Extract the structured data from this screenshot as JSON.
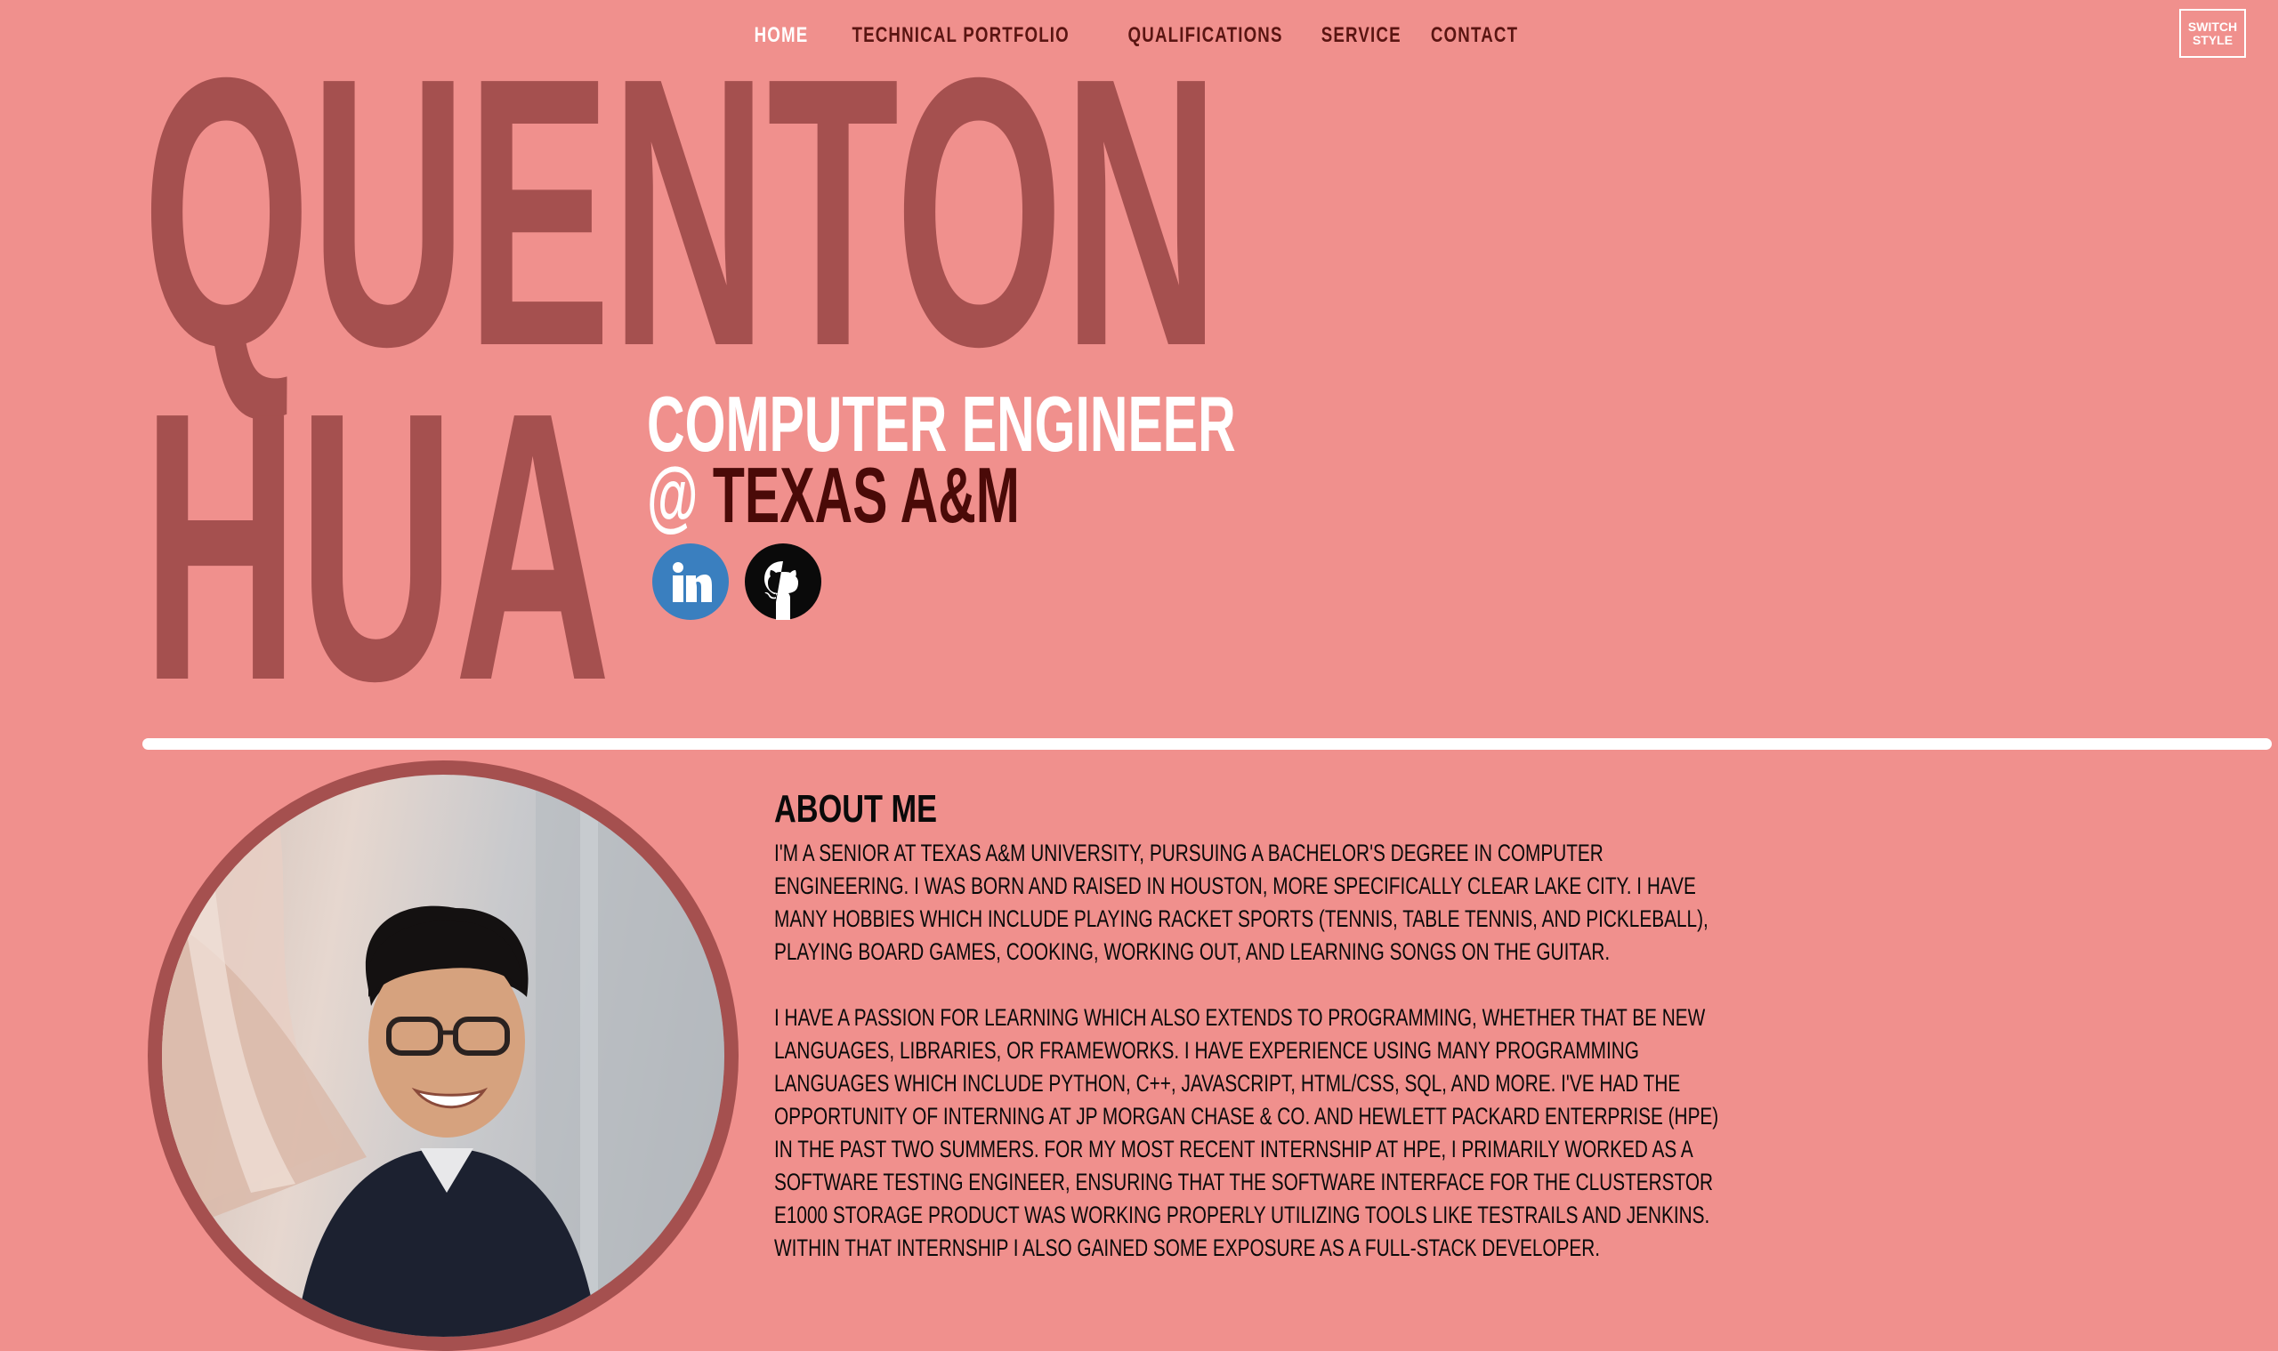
{
  "nav": {
    "items": [
      {
        "label": "HOME",
        "active": true
      },
      {
        "label": "TECHNICAL PORTFOLIO",
        "active": false
      },
      {
        "label": "QUALIFICATIONS",
        "active": false
      },
      {
        "label": "SERVICE",
        "active": false
      },
      {
        "label": "CONTACT",
        "active": false
      }
    ]
  },
  "switch_style": {
    "line1": "SWITCH",
    "line2": "STYLE"
  },
  "hero": {
    "first_name": "QUENTON",
    "last_name": "HUA",
    "role": "COMPUTER ENGINEER",
    "at": "@",
    "school": "TEXAS A&M"
  },
  "socials": {
    "linkedin_icon": "linkedin-icon",
    "github_icon": "github-icon",
    "linkedin_color": "#3a7fbf",
    "github_color": "#0a0a0a"
  },
  "about": {
    "title": "ABOUT ME",
    "paragraph1": "I'm a senior at Texas A&M University, pursuing a Bachelor's degree in Computer Engineering. I was born and raised in Houston, more specifically Clear Lake City. I have many hobbies which include playing racket sports (tennis, table tennis, and pickleball), playing board games, cooking, working out, and learning songs on the guitar.",
    "paragraph2": "I have a passion for learning which also extends to programming, whether that be new languages, libraries, or frameworks. I have experience using many programming languages which include Python, C++, JavaScript, HTML/CSS, SQL, and more. I've had the opportunity of interning at JP Morgan Chase & Co. and Hewlett Packard Enterprise (HPE) in the past two summers. For my most recent internship at HPE, I primarily worked as a software testing engineer, ensuring that the software interface for the ClusterStor E1000 storage product was working properly utilizing tools like TestRails and Jenkins. Within that internship I also gained some exposure as a full-stack developer."
  },
  "colors": {
    "background": "#f0908d",
    "name": "#a5504f",
    "accent_dark": "#4a0a08",
    "white": "#ffffff"
  }
}
